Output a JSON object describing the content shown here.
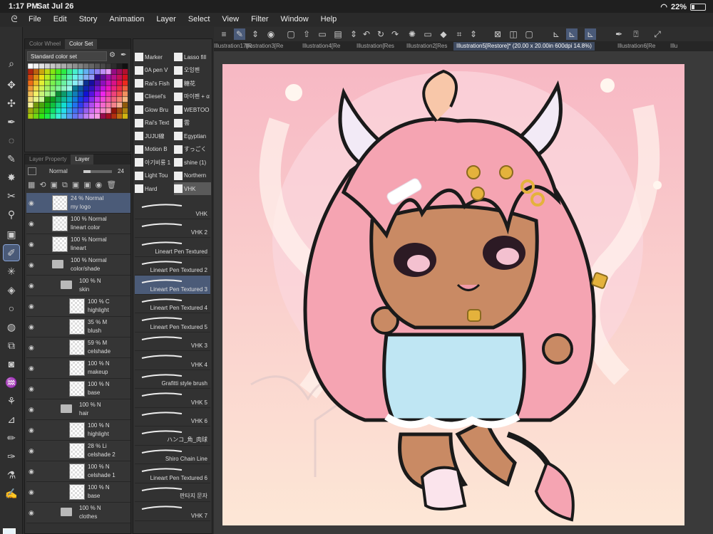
{
  "status": {
    "time": "1:17 PM",
    "date": "Sat Jul 26",
    "battery": "22%",
    "battery_level": 0.22
  },
  "menu": [
    "File",
    "Edit",
    "Story",
    "Animation",
    "Layer",
    "Select",
    "View",
    "Filter",
    "Window",
    "Help"
  ],
  "color_panel": {
    "tabs": [
      "Color Wheel",
      "Color Set"
    ],
    "set_name": "Standard color set"
  },
  "layer_panel": {
    "tabs": [
      "Layer Property",
      "Layer"
    ],
    "blend_mode": "Normal",
    "opacity": "24",
    "layers": [
      {
        "pct": "24 %  Normal",
        "name": "my logo",
        "depth": 0,
        "kind": "layer",
        "selected": true
      },
      {
        "pct": "100 %  Normal",
        "name": "lineart color",
        "depth": 0,
        "kind": "layer"
      },
      {
        "pct": "100 %  Normal",
        "name": "lineart",
        "depth": 0,
        "kind": "layer"
      },
      {
        "pct": "100 %  Normal",
        "name": "color/shade",
        "depth": 0,
        "kind": "folder"
      },
      {
        "pct": "100 %  N",
        "name": "skin",
        "depth": 1,
        "kind": "folder"
      },
      {
        "pct": "100 %  C",
        "name": "highlight",
        "depth": 2,
        "kind": "layer"
      },
      {
        "pct": "35 %  M",
        "name": "blush",
        "depth": 2,
        "kind": "layer"
      },
      {
        "pct": "59 %  M",
        "name": "celshade",
        "depth": 2,
        "kind": "layer"
      },
      {
        "pct": "100 %  N",
        "name": "makeup",
        "depth": 2,
        "kind": "layer"
      },
      {
        "pct": "100 %  N",
        "name": "base",
        "depth": 2,
        "kind": "layer"
      },
      {
        "pct": "100 %  N",
        "name": "hair",
        "depth": 1,
        "kind": "folder"
      },
      {
        "pct": "100 %  N",
        "name": "highlight",
        "depth": 2,
        "kind": "layer"
      },
      {
        "pct": "28 %  Li",
        "name": "celshade 2",
        "depth": 2,
        "kind": "layer"
      },
      {
        "pct": "100 %  N",
        "name": "celshade 1",
        "depth": 2,
        "kind": "layer"
      },
      {
        "pct": "100 %  N",
        "name": "base",
        "depth": 2,
        "kind": "layer"
      },
      {
        "pct": "100 %  N",
        "name": "clothes",
        "depth": 1,
        "kind": "folder"
      }
    ]
  },
  "brush_panel": {
    "sub_tools": [
      {
        "label": "Marker",
        "col": 0,
        "row": 0
      },
      {
        "label": "Lasso fill",
        "col": 1,
        "row": 0
      },
      {
        "label": "0A pen V",
        "col": 0,
        "row": 1
      },
      {
        "label": "오잉펜",
        "col": 1,
        "row": 1
      },
      {
        "label": "Rai's Fish",
        "col": 0,
        "row": 2
      },
      {
        "label": "糖花",
        "col": 1,
        "row": 2
      },
      {
        "label": "Cliesel's",
        "col": 0,
        "row": 3
      },
      {
        "label": "마이펜 + α",
        "col": 1,
        "row": 3
      },
      {
        "label": "Glow Bru",
        "col": 0,
        "row": 4
      },
      {
        "label": "WEBTOO",
        "col": 1,
        "row": 4
      },
      {
        "label": "Rai's Text",
        "col": 0,
        "row": 5
      },
      {
        "label": "雲",
        "col": 1,
        "row": 5
      },
      {
        "label": "JUJU線",
        "col": 0,
        "row": 6
      },
      {
        "label": "Egyptian",
        "col": 1,
        "row": 6
      },
      {
        "label": "Motion B",
        "col": 0,
        "row": 7
      },
      {
        "label": "すっごく",
        "col": 1,
        "row": 7
      },
      {
        "label": "아기비룡 1",
        "col": 0,
        "row": 8
      },
      {
        "label": "shine (1)",
        "col": 1,
        "row": 8
      },
      {
        "label": "Light Tou",
        "col": 0,
        "row": 9
      },
      {
        "label": "Northern",
        "col": 1,
        "row": 9
      },
      {
        "label": "Hard",
        "col": 0,
        "row": 10
      },
      {
        "label": "VHK",
        "col": 1,
        "row": 10,
        "selected": true
      }
    ],
    "brushes": [
      {
        "name": "VHK"
      },
      {
        "name": "VHK 2"
      },
      {
        "name": "Lineart Pen Textured"
      },
      {
        "name": "Lineart Pen Textured 2"
      },
      {
        "name": "Lineart Pen Textured 3",
        "selected": true
      },
      {
        "name": "Lineart Pen Textured 4"
      },
      {
        "name": "Lineart Pen Textured 5"
      },
      {
        "name": "VHK 3"
      },
      {
        "name": "VHK 4"
      },
      {
        "name": "Grafitti style brush"
      },
      {
        "name": "VHK 5"
      },
      {
        "name": "VHK 6"
      },
      {
        "name": "ハンコ_角_肉球"
      },
      {
        "name": "Shiro Chain Line"
      },
      {
        "name": "Lineart Pen Textured 6"
      },
      {
        "name": "판타지 문자"
      },
      {
        "name": "VHK 7"
      }
    ]
  },
  "doc_tabs": [
    {
      "label": "Illustration17[R"
    },
    {
      "label": "Illustration3[Re"
    },
    {
      "label": "Illustration4[Re"
    },
    {
      "label": "Illustration[Res"
    },
    {
      "label": "Illustration2[Res"
    },
    {
      "label": "Illustration5[Restore]* (20.00 x 20.00in 600dpi 14.8%)",
      "active": true
    },
    {
      "label": "Illustration6[Re"
    },
    {
      "label": "Illu"
    }
  ],
  "colors": {
    "main": "#e8f4fb",
    "sub": "#f2c9a6",
    "bg_top": "#f7b8c4",
    "bg_bottom": "#fde7d6",
    "hair": "#f5a4b2",
    "skin": "#c98a64",
    "overalls": "#bfe6f3",
    "horns": "#f2eaf6"
  }
}
